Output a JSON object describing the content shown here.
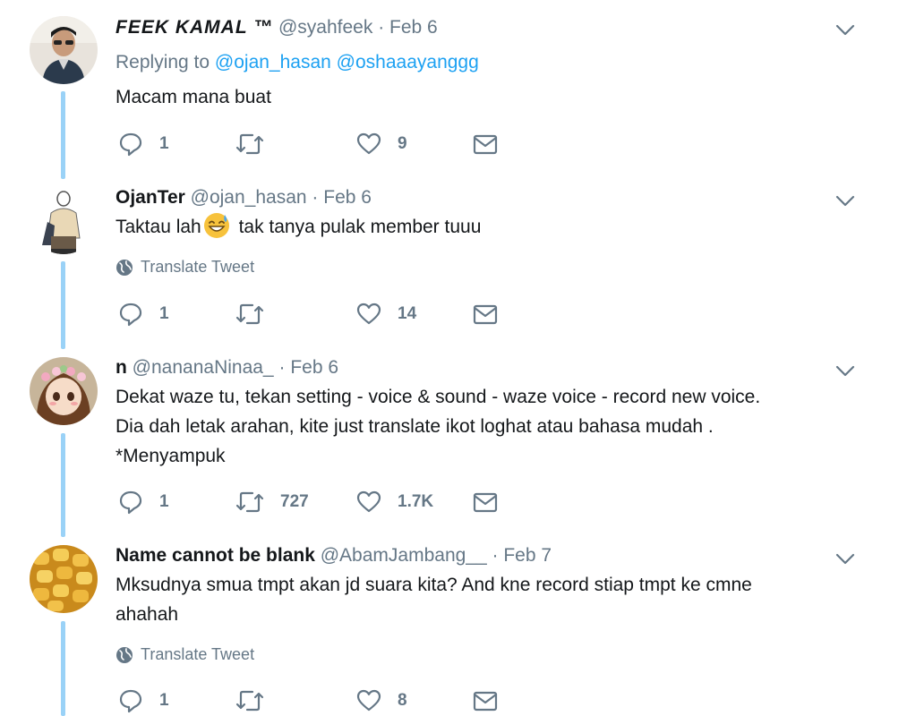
{
  "tweets": [
    {
      "name": "FEEK KAMAL ™",
      "handle": "@syahfeek",
      "dot": "·",
      "time": "Feb 6",
      "replying_prefix": "Replying to",
      "replying_to": [
        "@ojan_hasan",
        "@oshaaayanggg"
      ],
      "text": "Macam mana buat",
      "replies": "1",
      "retweets": "",
      "likes": "9"
    },
    {
      "name": "OjanTer",
      "handle": "@ojan_hasan",
      "dot": "·",
      "time": "Feb 6",
      "text_before": "Taktau lah",
      "text_after": " tak tanya pulak member tuuu",
      "emoji": "grinning-sweat-emoji",
      "translate": "Translate Tweet",
      "replies": "1",
      "retweets": "",
      "likes": "14"
    },
    {
      "name": "n",
      "handle": "@nananaNinaa_",
      "dot": "·",
      "time": "Feb 6",
      "lines": [
        "Dekat waze tu, tekan setting - voice & sound - waze voice - record new voice.",
        "Dia dah letak arahan, kite just translate ikot loghat atau bahasa mudah .",
        "*Menyampuk"
      ],
      "replies": "1",
      "retweets": "727",
      "likes": "1.7K"
    },
    {
      "name": "Name cannot be blank",
      "handle": "@AbamJambang__",
      "dot": "·",
      "time": "Feb 7",
      "lines": [
        "Mksudnya smua tmpt akan jd suara kita? And kne record stiap tmpt ke cmne",
        "ahahah"
      ],
      "translate": "Translate Tweet",
      "replies": "1",
      "retweets": "",
      "likes": "8"
    }
  ],
  "colors": {
    "thread_line": "#9ad2f7",
    "link": "#1da1f2",
    "muted": "#657786",
    "text": "#14171a"
  }
}
